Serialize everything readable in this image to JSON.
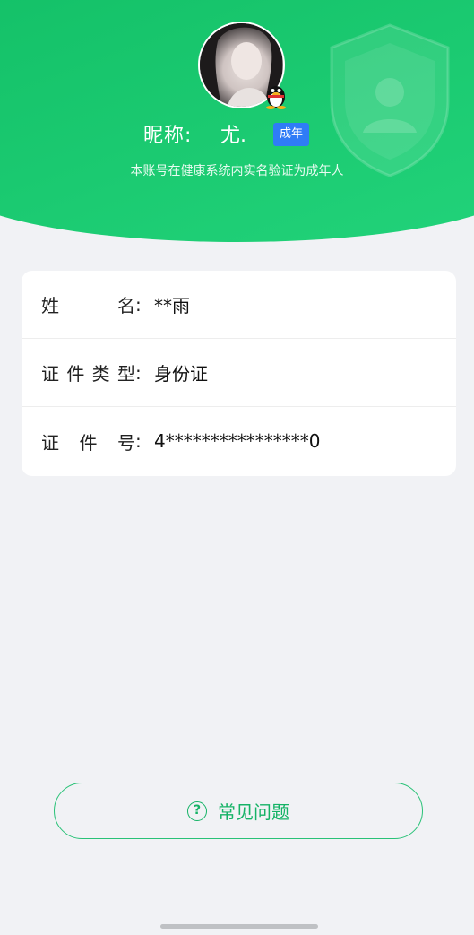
{
  "header": {
    "nickname_label": "昵称:",
    "nickname_value": "尤.",
    "status_badge": "成年",
    "subtitle": "本账号在健康系统内实名验证为成年人",
    "accent": "#14c168",
    "badge_color": "#2f7cf6",
    "avatar_icon": "user-avatar",
    "qq_icon": "qq-penguin-icon"
  },
  "info": {
    "rows": [
      {
        "label_chars": [
          "姓",
          "名"
        ],
        "value": "**雨"
      },
      {
        "label_chars": [
          "证",
          "件",
          "类",
          "型"
        ],
        "value": "身份证"
      },
      {
        "label_chars": [
          "证",
          "件",
          "号"
        ],
        "value": "4****************0"
      }
    ],
    "colon": ":"
  },
  "faq": {
    "label": "常见问题",
    "icon_glyph": "?",
    "icon": "question-circle-icon"
  }
}
